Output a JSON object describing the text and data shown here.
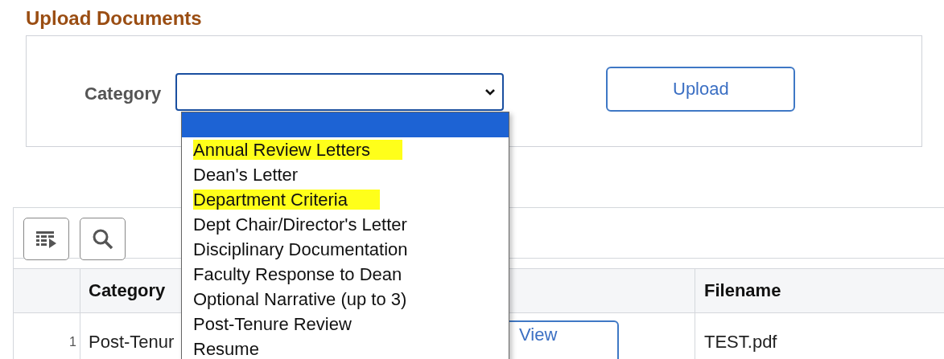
{
  "title": "Upload Documents",
  "upload_panel": {
    "category_label": "Category",
    "upload_button": "Upload"
  },
  "category_dropdown": {
    "open": true,
    "options": [
      {
        "selected": true
      },
      {
        "label": "Annual Review Letters",
        "selected": false,
        "highlighted": true
      },
      {
        "label": "Dean's Letter",
        "selected": false,
        "highlighted": false
      },
      {
        "label": "Department Criteria",
        "selected": false,
        "highlighted": true
      },
      {
        "label": "Dept Chair/Director's Letter",
        "selected": false,
        "highlighted": false
      },
      {
        "label": "Disciplinary Documentation",
        "selected": false,
        "highlighted": false
      },
      {
        "label": "Faculty Response to Dean",
        "selected": false,
        "highlighted": false
      },
      {
        "label": "Optional Narrative (up to 3)",
        "selected": false,
        "highlighted": false
      },
      {
        "label": "Post-Tenure Review",
        "selected": false,
        "highlighted": false
      },
      {
        "label": "Resume",
        "selected": false,
        "highlighted": false
      }
    ]
  },
  "table": {
    "columns": [
      "Category",
      "Filename"
    ],
    "rows": [
      {
        "number": "1",
        "category": "Post-Tenur",
        "view_button": "View",
        "filename": "TEST.pdf"
      }
    ]
  }
}
